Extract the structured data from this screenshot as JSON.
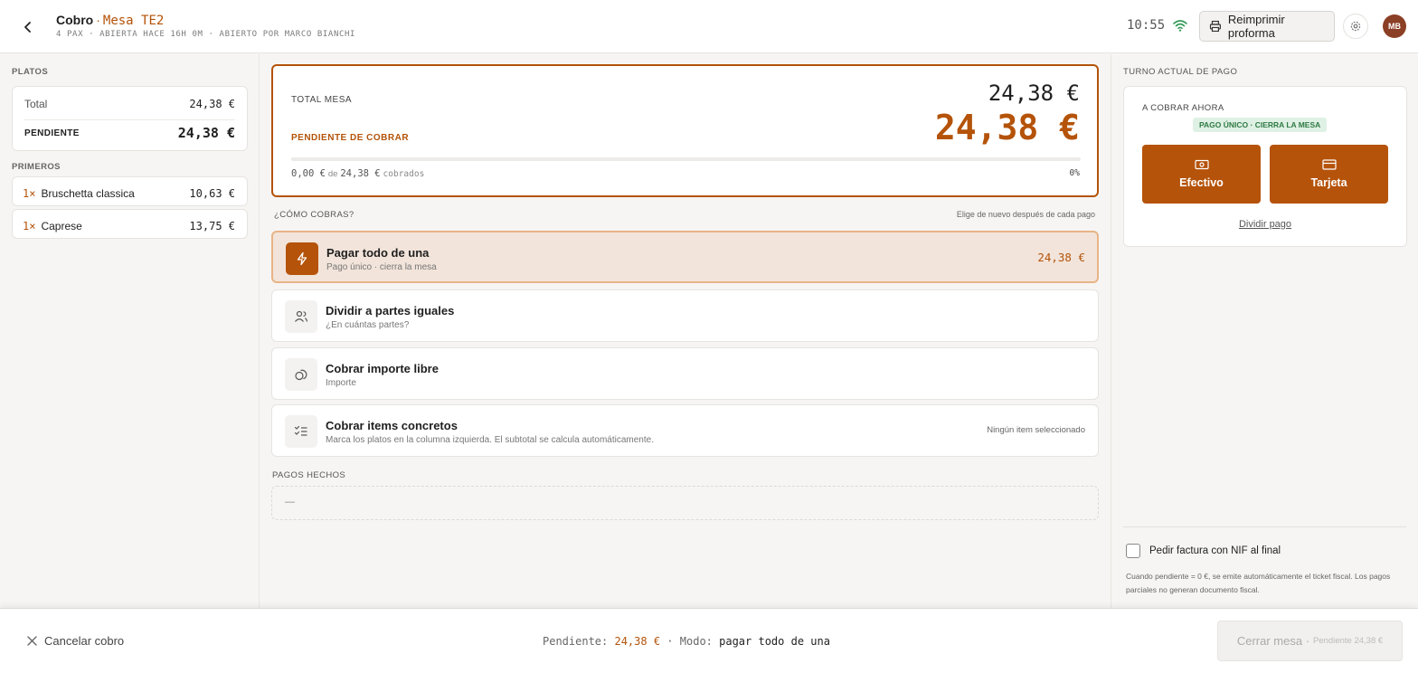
{
  "header": {
    "title": "Cobro",
    "title_sep": "·",
    "table": "Mesa TE2",
    "subtitle": "4 PAX · ABIERTA HACE 16H 0M · ABIERTO POR MARCO BIANCHI",
    "time": "10:55",
    "reprint_label": "Reimprimir proforma",
    "avatar_initials": "MB"
  },
  "left": {
    "platos_label": "PLATOS",
    "total_label": "Total",
    "total_value": "24,38 €",
    "pending_label": "PENDIENTE",
    "pending_value": "24,38 €",
    "primeros_label": "PRIMEROS",
    "items": [
      {
        "qty": "1×",
        "name": "Bruschetta classica",
        "price": "10,63 €"
      },
      {
        "qty": "1×",
        "name": "Caprese",
        "price": "13,75 €"
      }
    ]
  },
  "summary": {
    "total_label": "TOTAL MESA",
    "total_value": "24,38 €",
    "pending_label": "PENDIENTE DE COBRAR",
    "pending_value": "24,38 €",
    "collected": "0,00 €",
    "of_word": "de",
    "of_total": "24,38 €",
    "collected_word": "cobrados",
    "percent": "0%",
    "progress_fraction": 0
  },
  "how": {
    "label": "¿CÓMO COBRAS?",
    "hint": "Elige de nuevo después de cada pago",
    "options": [
      {
        "title": "Pagar todo de una",
        "sub": "Pago único · cierra la mesa",
        "right": "24,38 €"
      },
      {
        "title": "Dividir a partes iguales",
        "sub": "¿En cuántas partes?",
        "right": ""
      },
      {
        "title": "Cobrar importe libre",
        "sub": "Importe",
        "right": ""
      },
      {
        "title": "Cobrar items concretos",
        "sub": "Marca los platos en la columna izquierda. El subtotal se calcula automáticamente.",
        "right": "Ningún item seleccionado"
      }
    ]
  },
  "payments": {
    "label": "PAGOS HECHOS",
    "empty": "—"
  },
  "right": {
    "turn_label": "TURNO ACTUAL DE PAGO",
    "now_label": "A COBRAR AHORA",
    "badge": "PAGO ÚNICO · CIERRA LA MESA",
    "cash_label": "Efectivo",
    "card_label": "Tarjeta",
    "split_label": "Dividir pago",
    "invoice_label": "Pedir factura con NIF al final",
    "note": "Cuando pendiente = 0 €, se emite automáticamente el ticket fiscal. Los pagos parciales no generan documento fiscal."
  },
  "footer": {
    "cancel_label": "Cancelar cobro",
    "pending_label": "Pendiente:",
    "pending_value": "24,38 €",
    "dot": "·",
    "mode_label": "Modo:",
    "mode_value": "pagar todo de una",
    "close_label": "Cerrar mesa ·",
    "close_pending": "Pendiente 24,38 €"
  },
  "colors": {
    "accent": "#b5530a",
    "accent_text": "#b45309",
    "active_bg": "#f2e4da",
    "badge_bg": "#dff1e4",
    "badge_text": "#2f7a45"
  },
  "icons": [
    "back-arrow-icon",
    "wifi-icon",
    "printer-icon",
    "gear-icon",
    "bolt-icon",
    "users-icon",
    "coins-icon",
    "checklist-icon",
    "cash-icon",
    "card-icon",
    "close-icon"
  ]
}
